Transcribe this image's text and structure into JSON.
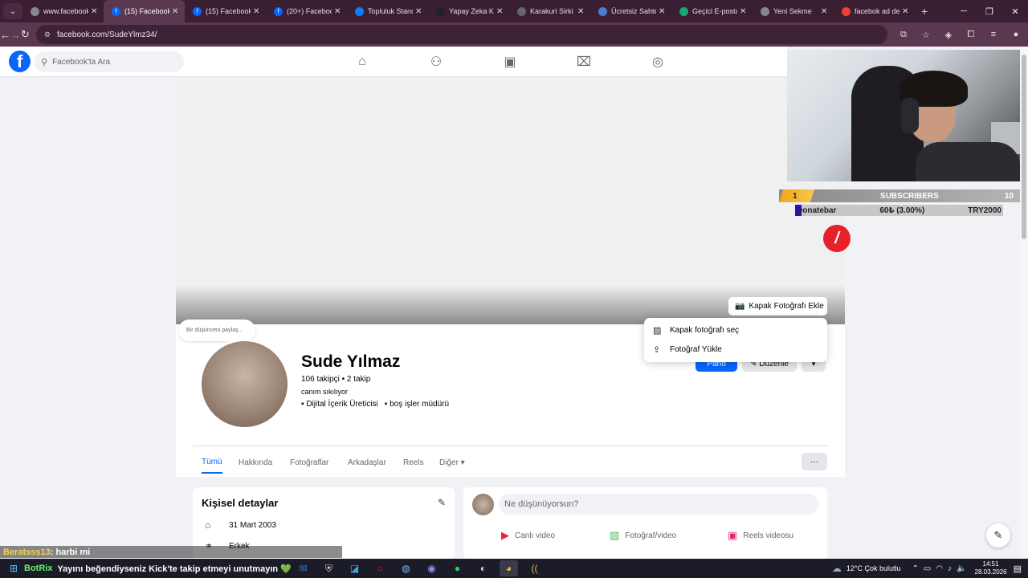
{
  "browser": {
    "tabs": [
      {
        "title": "www.facebook",
        "icon": "globe",
        "color": "#888888"
      },
      {
        "title": "(15) Facebook",
        "icon": "facebook",
        "color": "#0866ff",
        "active": true
      },
      {
        "title": "(15) Facebook",
        "icon": "facebook",
        "color": "#0866ff"
      },
      {
        "title": "(20+) Faceboo",
        "icon": "facebook",
        "color": "#0866ff"
      },
      {
        "title": "Topluluk Stand",
        "icon": "meta",
        "color": "#0a7cff"
      },
      {
        "title": "Yapay Zeka Ka",
        "icon": "x-logo",
        "color": "#222222"
      },
      {
        "title": "Karakuri Sirki",
        "icon": "mountain",
        "color": "#666666"
      },
      {
        "title": "Ücretsiz Sahte",
        "icon": "lock",
        "color": "#4a7dd1"
      },
      {
        "title": "Geçici E-posta",
        "icon": "mail",
        "color": "#19a974"
      },
      {
        "title": "Yeni Sekme",
        "icon": "globe",
        "color": "#888888"
      },
      {
        "title": "facebok ad de",
        "icon": "google",
        "color": "#ea4335"
      }
    ],
    "url": "facebook.com/SudeYlmz34/"
  },
  "facebook": {
    "search_placeholder": "Facebook'ta Ara",
    "cover_button": "Kapak Fotoğrafı Ekle",
    "dropdown": [
      "Kapak fotoğrafı seç",
      "Fotoğraf Yükle"
    ],
    "bubble": "Bir düşünceni paylaş...",
    "profile": {
      "name": "Sude Yılmaz",
      "stats": "106 takipçi • 2 takip",
      "bio": "canım sıkılıyor",
      "tags": [
        "Dijital İçerik Üreticisi",
        "boş işler müdürü"
      ]
    },
    "buttons": {
      "pano": "Pano",
      "edit": "Düzenle"
    },
    "tabs": [
      "Tümü",
      "Hakkında",
      "Fotoğraflar",
      "Arkadaşlar",
      "Reels",
      "Diğer"
    ],
    "details": {
      "title": "Kişisel detaylar",
      "birthday": "31 Mart 2003",
      "gender": "Erkek"
    },
    "composer": {
      "placeholder": "Ne düşünüyorsun?",
      "actions": [
        "Canlı video",
        "Fotoğraf/video",
        "Reels videosu"
      ]
    }
  },
  "stream": {
    "subs_rank": "1",
    "subs_label": "SUBSCRIBERS",
    "subs_count": "10",
    "donate_label": "Donatebar",
    "donate_value": "60₺ (3.00%)",
    "donate_goal": "TRY2000",
    "donate_progress": 0.03,
    "chat_user": "Beratsss13",
    "chat_msg": ": harbi mi",
    "bot_name": "BotRix",
    "bot_msg": "Yayını beğendiyseniz Kick'te takip etmeyi unutmayın 💚"
  },
  "taskbar": {
    "weather": "12°C  Çok bulutlu",
    "time": "14:51",
    "date": "28.03.2026"
  }
}
